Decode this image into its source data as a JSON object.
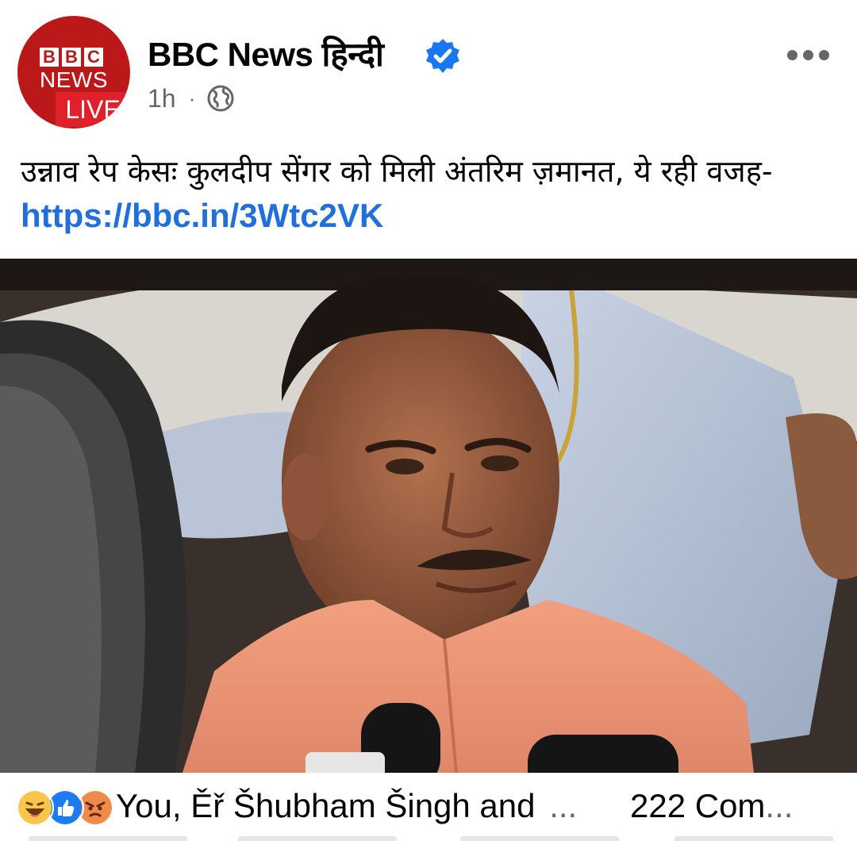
{
  "post": {
    "page_name": "BBC News हिन्दी",
    "avatar": {
      "bbc_letters": [
        "B",
        "B",
        "C"
      ],
      "news": "NEWS",
      "live": "LIVE"
    },
    "time": "1h",
    "separator": "·",
    "privacy_icon": "globe-icon",
    "verified_icon": "verified-badge-icon",
    "more_icon": "more-options-icon",
    "text": "उन्नाव रेप केसः कुलदीप सेंगर को मिली अंतरिम ज़मानत, ये रही वजह-",
    "link": "https://bbc.in/3Wtc2VK"
  },
  "engagement": {
    "reactions": [
      "haha",
      "like",
      "angry"
    ],
    "reactors": "You, Ěř Šhubham Šingh and",
    "reactors_more": "...",
    "comments": "222 Com",
    "comments_more": "..."
  },
  "colors": {
    "bbc_red": "#bb1919",
    "live_red": "#e0202a",
    "link_blue": "#216fdb",
    "verified_blue": "#1877f2",
    "meta_gray": "#65676b"
  }
}
